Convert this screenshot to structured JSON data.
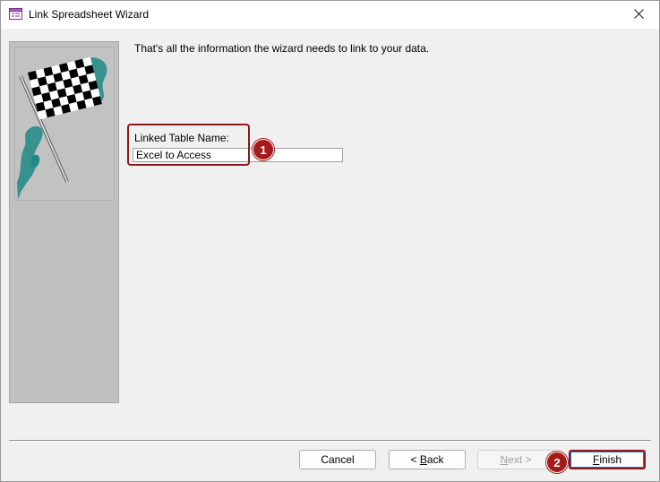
{
  "window": {
    "title": "Link Spreadsheet Wizard",
    "icon": "table-wizard-icon",
    "close_icon": "close-icon"
  },
  "side_panel": {
    "image": "checkered-flag-image"
  },
  "main": {
    "intro_text": "That's all the information the wizard needs to link to your data.",
    "linked_table_label": "Linked Table Name:",
    "linked_table_value": "Excel to Access"
  },
  "annotations": {
    "badge1": "1",
    "badge2": "2",
    "color": "#a51b1b"
  },
  "buttons": {
    "cancel": "Cancel",
    "back_prefix": "< ",
    "back_mnemonic": "B",
    "back_rest": "ack",
    "next_mnemonic": "N",
    "next_rest": "ext >",
    "finish_mnemonic": "F",
    "finish_rest": "inish"
  }
}
